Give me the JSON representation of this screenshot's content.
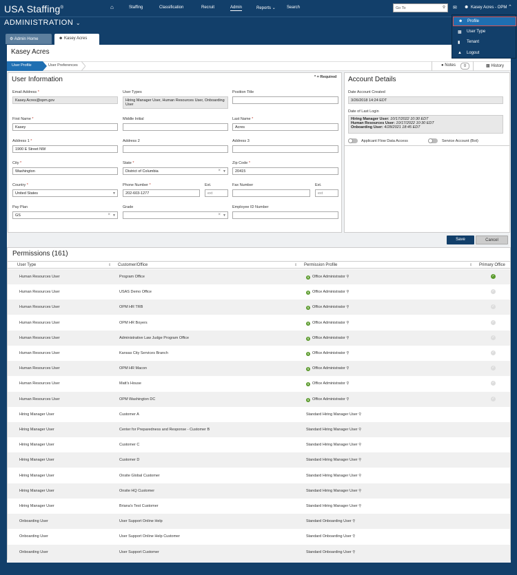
{
  "app": {
    "logo": "USA Staffing",
    "logo_mark": "®"
  },
  "topnav": {
    "items": [
      {
        "label": "Staffing"
      },
      {
        "label": "Classification"
      },
      {
        "label": "Recruit"
      },
      {
        "label": "Admin"
      },
      {
        "label": "Reports"
      },
      {
        "label": "Search"
      }
    ],
    "goto_placeholder": "Go To",
    "user_label": "Kasey Acres - OPM"
  },
  "section_title": "ADMINISTRATION",
  "tabs": [
    {
      "label": "Admin Home"
    },
    {
      "label": "Kasey Acres"
    }
  ],
  "page_title": "Kasey Acres",
  "breadcrumb": {
    "active": "User Profile",
    "next": "User Preferences"
  },
  "actions": {
    "notes_label": "Notes",
    "notes_count": "0",
    "history_label": "History"
  },
  "user_info": {
    "title": "User Information",
    "required_note": "* = Required",
    "email_label": "Email Address",
    "email": "Kasey.Acres@opm.gov",
    "user_types_label": "User Types",
    "user_types": "Hiring Manager User, Human Resources User, Onboarding User",
    "position_title_label": "Position Title",
    "position_title": "",
    "first_name_label": "First Name",
    "first_name": "Kasey",
    "middle_initial_label": "Middle Initial",
    "middle_initial": "",
    "last_name_label": "Last Name",
    "last_name": "Acres",
    "address1_label": "Address 1",
    "address1": "1900 E Street NW",
    "address2_label": "Address 2",
    "address2": "",
    "address3_label": "Address 3",
    "address3": "",
    "city_label": "City",
    "city": "Washington",
    "state_label": "State",
    "state": "District of Columbia",
    "zip_label": "Zip Code",
    "zip": "20415",
    "country_label": "Country",
    "country": "United States",
    "phone_label": "Phone Number",
    "phone": "202-603-1277",
    "ext_label": "Ext.",
    "ext_placeholder": "ext",
    "fax_label": "Fax Number",
    "fax": "",
    "fax_ext_label": "Ext.",
    "fax_ext_placeholder": "ext",
    "pay_plan_label": "Pay Plan",
    "pay_plan": "GS",
    "grade_label": "Grade",
    "grade": "",
    "employee_id_label": "Employee ID Number",
    "employee_id": ""
  },
  "account": {
    "title": "Account Details",
    "created_label": "Date Account Created",
    "created": "3/26/2018 14:24 EDT",
    "last_login_label": "Date of Last Login",
    "logins": [
      {
        "type": "Hiring Manager User:",
        "date": "10/17/2022 10:30 EDT"
      },
      {
        "type": "Human Resources User:",
        "date": "10/17/2022 10:30 EDT"
      },
      {
        "type": "Onboarding User:",
        "date": "4/28/2021 18:45 EDT"
      }
    ],
    "toggle1": "Applicant Flow Data Access",
    "toggle2": "Service Account (Bot)"
  },
  "buttons": {
    "save": "Save",
    "cancel": "Cancel"
  },
  "permissions": {
    "title": "Permissions (161)",
    "headers": [
      "User Type",
      "Customer/Office",
      "Permission Profile",
      "Primary Office"
    ],
    "rows": [
      {
        "type": "Human Resources User",
        "office": "Program Office",
        "profile": "Office Administrator",
        "primary": true
      },
      {
        "type": "Human Resources User",
        "office": "USAS Demo Office",
        "profile": "Office Administrator",
        "primary": false
      },
      {
        "type": "Human Resources User",
        "office": "OPM HR TRB",
        "profile": "Office Administrator",
        "primary": false
      },
      {
        "type": "Human Resources User",
        "office": "OPM HR Boyers",
        "profile": "Office Administrator",
        "primary": false
      },
      {
        "type": "Human Resources User",
        "office": "Administrative Law Judge Program Office",
        "profile": "Office Administrator",
        "primary": false
      },
      {
        "type": "Human Resources User",
        "office": "Kansas City Services Branch",
        "profile": "Office Administrator",
        "primary": false
      },
      {
        "type": "Human Resources User",
        "office": "OPM HR Macon",
        "profile": "Office Administrator",
        "primary": false
      },
      {
        "type": "Human Resources User",
        "office": "Matt's House",
        "profile": "Office Administrator",
        "primary": false
      },
      {
        "type": "Human Resources User",
        "office": "OPM Washington DC",
        "profile": "Office Administrator",
        "primary": false
      },
      {
        "type": "Hiring Manager User",
        "office": "Customer A",
        "profile": "Standard Hiring Manager User",
        "primary": null
      },
      {
        "type": "Hiring Manager User",
        "office": "Center for Preparedness and Response - Customer B",
        "profile": "Standard Hiring Manager User",
        "primary": null
      },
      {
        "type": "Hiring Manager User",
        "office": "Customer C",
        "profile": "Standard Hiring Manager User",
        "primary": null
      },
      {
        "type": "Hiring Manager User",
        "office": "Customer D",
        "profile": "Standard Hiring Manager User",
        "primary": null
      },
      {
        "type": "Hiring Manager User",
        "office": "Onsite Global Customer",
        "profile": "Standard Hiring Manager User",
        "primary": null
      },
      {
        "type": "Hiring Manager User",
        "office": "Onsite HQ Customer",
        "profile": "Standard Hiring Manager User",
        "primary": null
      },
      {
        "type": "Hiring Manager User",
        "office": "Briana's Test Customer",
        "profile": "Standard Hiring Manager User",
        "primary": null
      },
      {
        "type": "Onboarding User",
        "office": "User Support Online Help",
        "profile": "Standard Onboarding User",
        "primary": null
      },
      {
        "type": "Onboarding User",
        "office": "User Support Online Help Customer",
        "profile": "Standard Onboarding User",
        "primary": null
      },
      {
        "type": "Onboarding User",
        "office": "User Support Customer",
        "profile": "Standard Onboarding User",
        "primary": null
      }
    ]
  },
  "user_menu": {
    "items": [
      {
        "label": "Profile",
        "icon": "person-icon"
      },
      {
        "label": "User Type",
        "icon": "id-card-icon"
      },
      {
        "label": "Tenant",
        "icon": "building-icon"
      },
      {
        "label": "Logout",
        "icon": "lock-icon"
      }
    ]
  },
  "colors": {
    "brand": "#123f6a",
    "accent": "#1f6fb2",
    "check": "#5a9a2c"
  }
}
